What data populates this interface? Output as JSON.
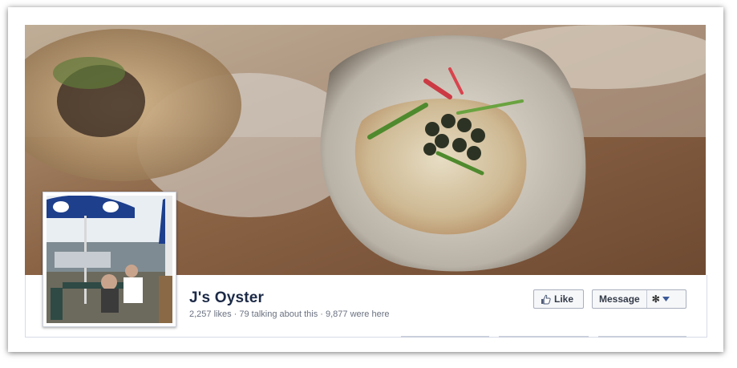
{
  "page": {
    "name": "J's Oyster",
    "stats": "2,257 likes · 79 talking about this · 9,877 were here"
  },
  "actions": {
    "like_label": "Like",
    "message_label": "Message"
  },
  "icons": {
    "like": "thumbs-up-icon",
    "settings": "gear-icon",
    "dropdown": "caret-down-icon"
  },
  "colors": {
    "title": "#1c2a47",
    "stats": "#6a7180",
    "button_bg": "#f6f7f9",
    "caret": "#3b5998"
  }
}
